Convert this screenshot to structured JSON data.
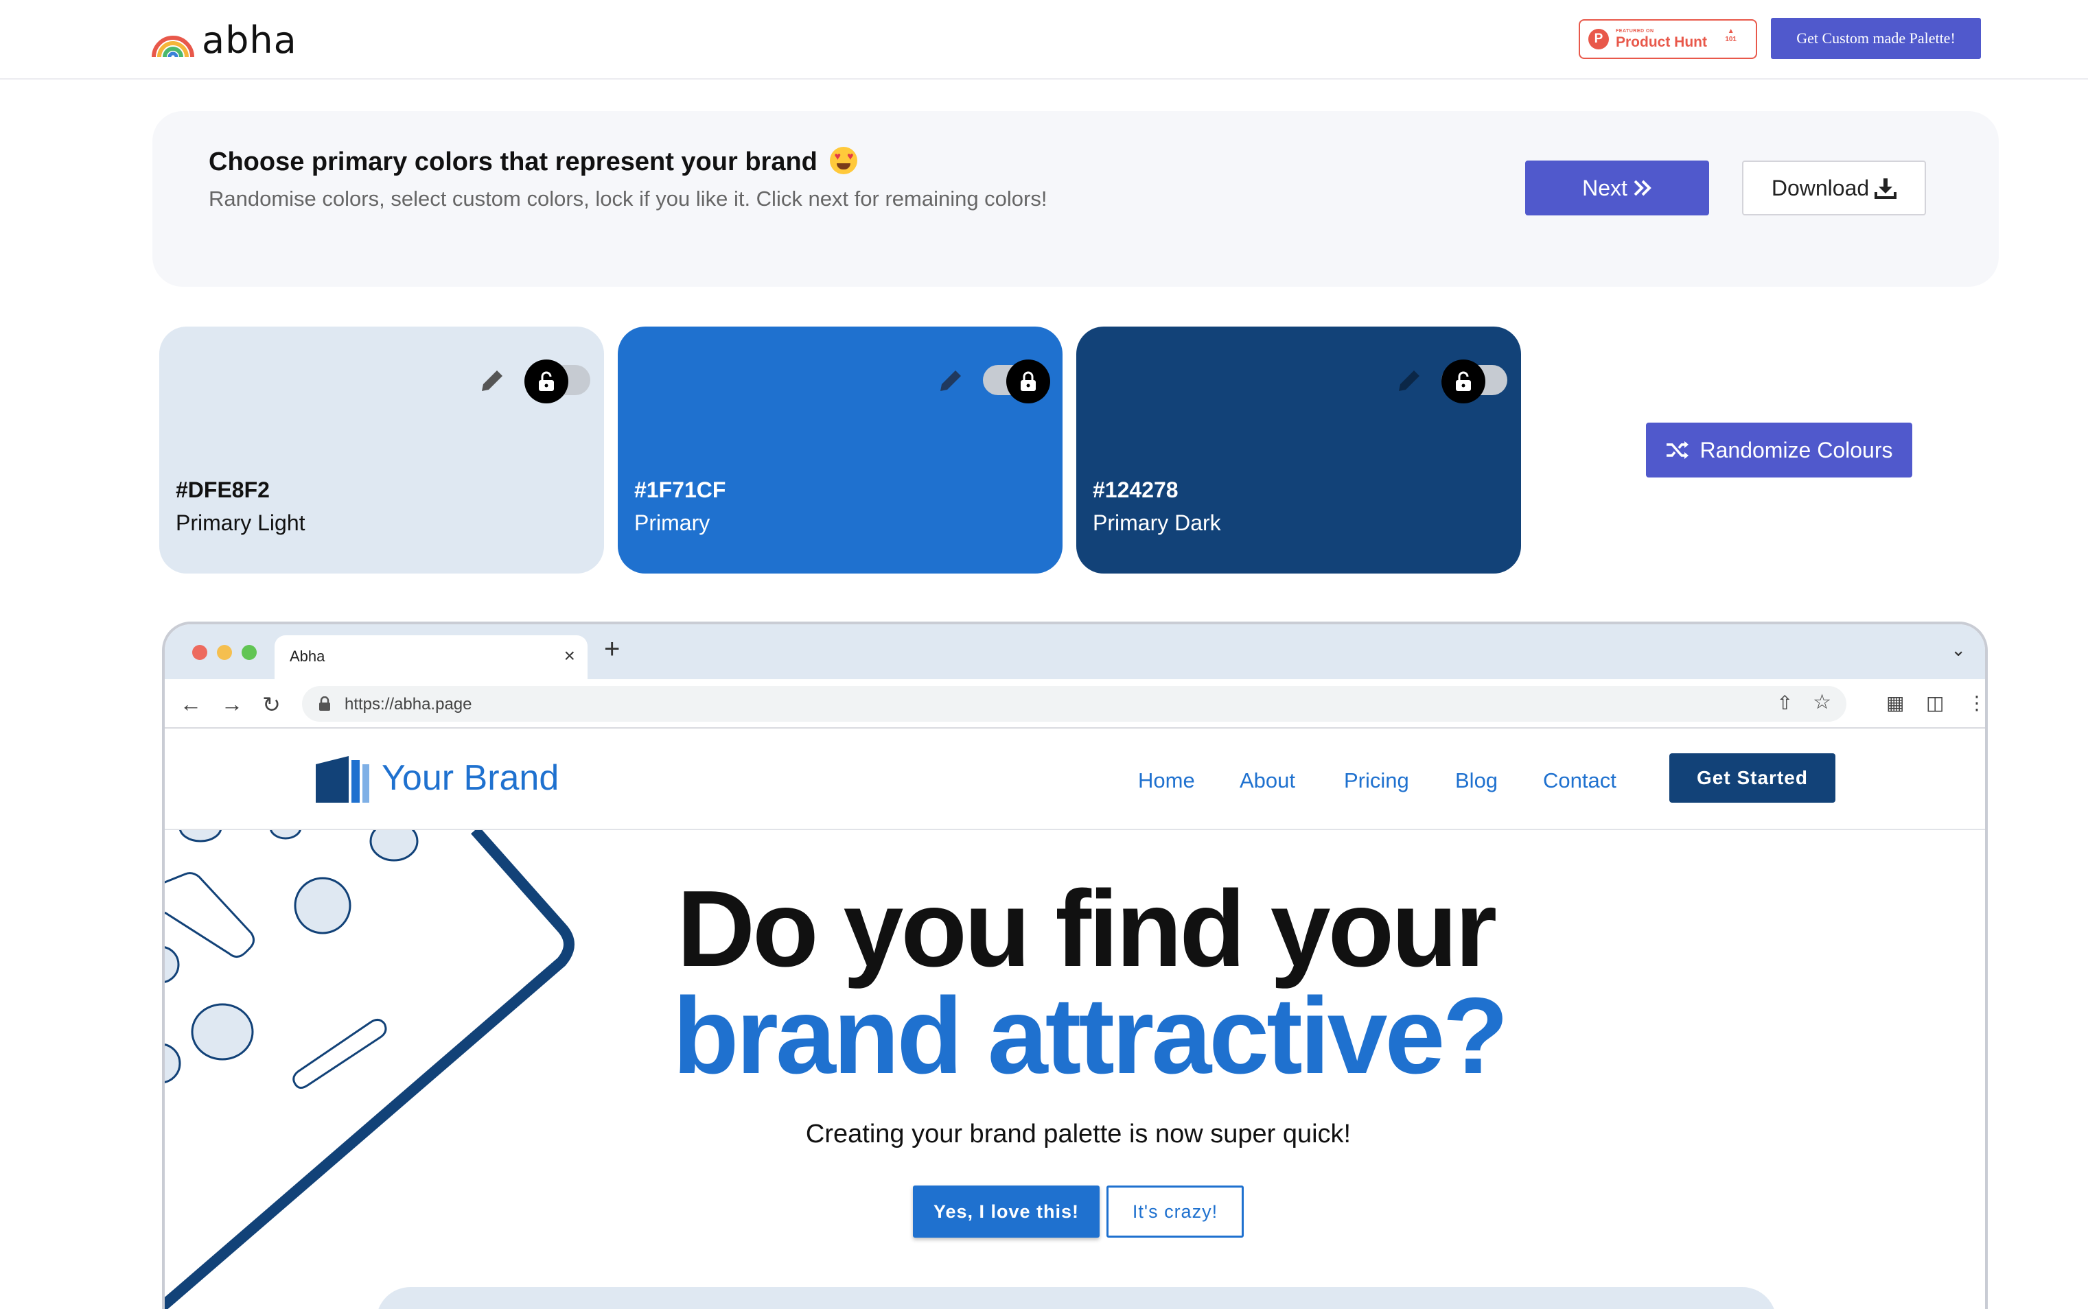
{
  "app": {
    "logo_text": "abha",
    "product_hunt": {
      "small": "FEATURED ON",
      "big": "Product Hunt",
      "votes": "101"
    },
    "custom_palette_label": "Get Custom made Palette!"
  },
  "panel": {
    "title": "Choose primary colors that represent your brand",
    "subtitle": "Randomise colors, select custom colors, lock if you like it. Click next for remaining colors!",
    "next_label": "Next",
    "download_label": "Download"
  },
  "swatches": [
    {
      "hex": "#DFE8F2",
      "name": "Primary Light",
      "color": "#DFE8F2",
      "text_color": "#111111",
      "locked": false
    },
    {
      "hex": "#1F71CF",
      "name": "Primary",
      "color": "#1F71CF",
      "text_color": "#ffffff",
      "locked": true
    },
    {
      "hex": "#124278",
      "name": "Primary Dark",
      "color": "#124278",
      "text_color": "#ffffff",
      "locked": false
    }
  ],
  "randomize_label": "Randomize Colours",
  "browser": {
    "tab_title": "Abha",
    "url": "https://abha.page"
  },
  "site": {
    "brand": "Your Brand",
    "nav": [
      "Home",
      "About",
      "Pricing",
      "Blog",
      "Contact"
    ],
    "cta": "Get Started",
    "hero_line1": "Do you find your",
    "hero_line2": "brand attractive?",
    "hero_sub": "Creating your brand palette is now super quick!",
    "primary_btn": "Yes, I love this!",
    "secondary_btn": "It's crazy!"
  },
  "colors": {
    "accent": "#5059CC",
    "primary_light": "#DFE8F2",
    "primary": "#1F71CF",
    "primary_dark": "#124278"
  }
}
